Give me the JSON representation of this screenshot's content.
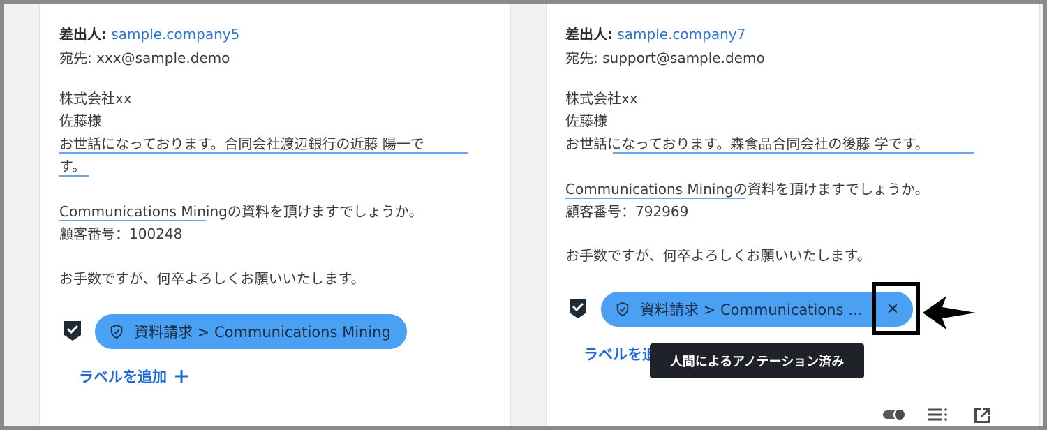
{
  "left_email": {
    "from_label": "差出人:",
    "from_value": "sample.company5",
    "to_label": "宛先:",
    "to_value": "xxx@sample.demo",
    "body": {
      "line1": "株式会社xx",
      "line2": "佐藤様",
      "line3": "お世話になっております。合同会社渡辺銀行の近藤 陽一で",
      "line4": "す。",
      "line5": "Communications Miningの資料を頂けますでしょうか。",
      "line6": "顧客番号：100248",
      "line7": "お手数ですが、何卒よろしくお願いいたします。"
    },
    "label_chip": "資料請求 > Communications Mining",
    "add_label": "ラベルを追加"
  },
  "right_email": {
    "from_label": "差出人:",
    "from_value": "sample.company7",
    "to_label": "宛先:",
    "to_value": "support@sample.demo",
    "body": {
      "line1": "株式会社xx",
      "line2": "佐藤様",
      "line3": "お世話になっております。森食品合同会社の後藤 学です。",
      "line4": "Communications Miningの資料を頂けますでしょうか。",
      "line5": "顧客番号：792969",
      "line6": "お手数ですが、何卒よろしくお願いいたします。"
    },
    "label_chip": "資料請求 > Communications M...",
    "add_label": "ラベルを追",
    "tooltip": "人間によるアノテーション済み"
  },
  "icons": {
    "shield_tile": "shield-check-icon",
    "chip_icon": "shield-check-outline-icon",
    "close": "close-icon",
    "plus": "plus-icon",
    "toggle": "toggle-icon",
    "list": "list-icon",
    "open_external": "open-external-icon",
    "arrow": "arrow-pointer"
  },
  "colors": {
    "link": "#2f76d2",
    "chip_bg": "#4aa0f2",
    "underline": "#6aa6ec",
    "tooltip_bg": "#1f2329",
    "add_label": "#1f6ad8"
  }
}
